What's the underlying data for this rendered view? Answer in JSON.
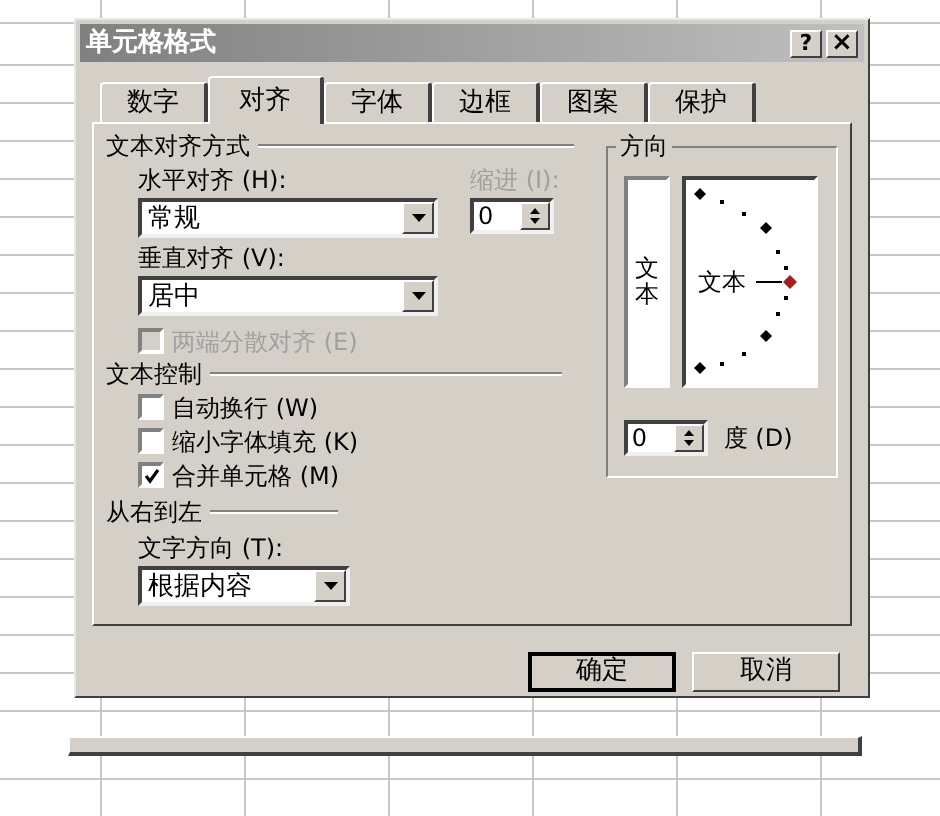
{
  "dialog": {
    "title": "单元格格式",
    "help_button": "?",
    "close_button": "×"
  },
  "tabs": [
    {
      "label": "数字",
      "selected": false
    },
    {
      "label": "对齐",
      "selected": true
    },
    {
      "label": "字体",
      "selected": false
    },
    {
      "label": "边框",
      "selected": false
    },
    {
      "label": "图案",
      "selected": false
    },
    {
      "label": "保护",
      "selected": false
    }
  ],
  "text_alignment": {
    "heading": "文本对齐方式",
    "horizontal": {
      "label": "水平对齐 (H):",
      "value": "常规"
    },
    "indent": {
      "label": "缩进 (I):",
      "value": "0",
      "disabled": true
    },
    "vertical": {
      "label": "垂直对齐 (V):",
      "value": "居中"
    },
    "justify_distributed": {
      "label": "两端分散对齐 (E)",
      "checked": false,
      "disabled": true
    }
  },
  "text_control": {
    "heading": "文本控制",
    "options": [
      {
        "label": "自动换行 (W)",
        "checked": false
      },
      {
        "label": "缩小字体填充 (K)",
        "checked": false
      },
      {
        "label": "合并单元格 (M)",
        "checked": true
      }
    ]
  },
  "right_to_left": {
    "heading": "从右到左",
    "direction": {
      "label": "文字方向 (T):",
      "value": "根据内容"
    }
  },
  "orientation": {
    "heading": "方向",
    "vertical_text": "文本",
    "dial_text": "文本",
    "degrees": {
      "value": "0",
      "label": "度 (D)"
    }
  },
  "buttons": [
    {
      "label": "确定",
      "default": true
    },
    {
      "label": "取消",
      "default": false
    }
  ]
}
